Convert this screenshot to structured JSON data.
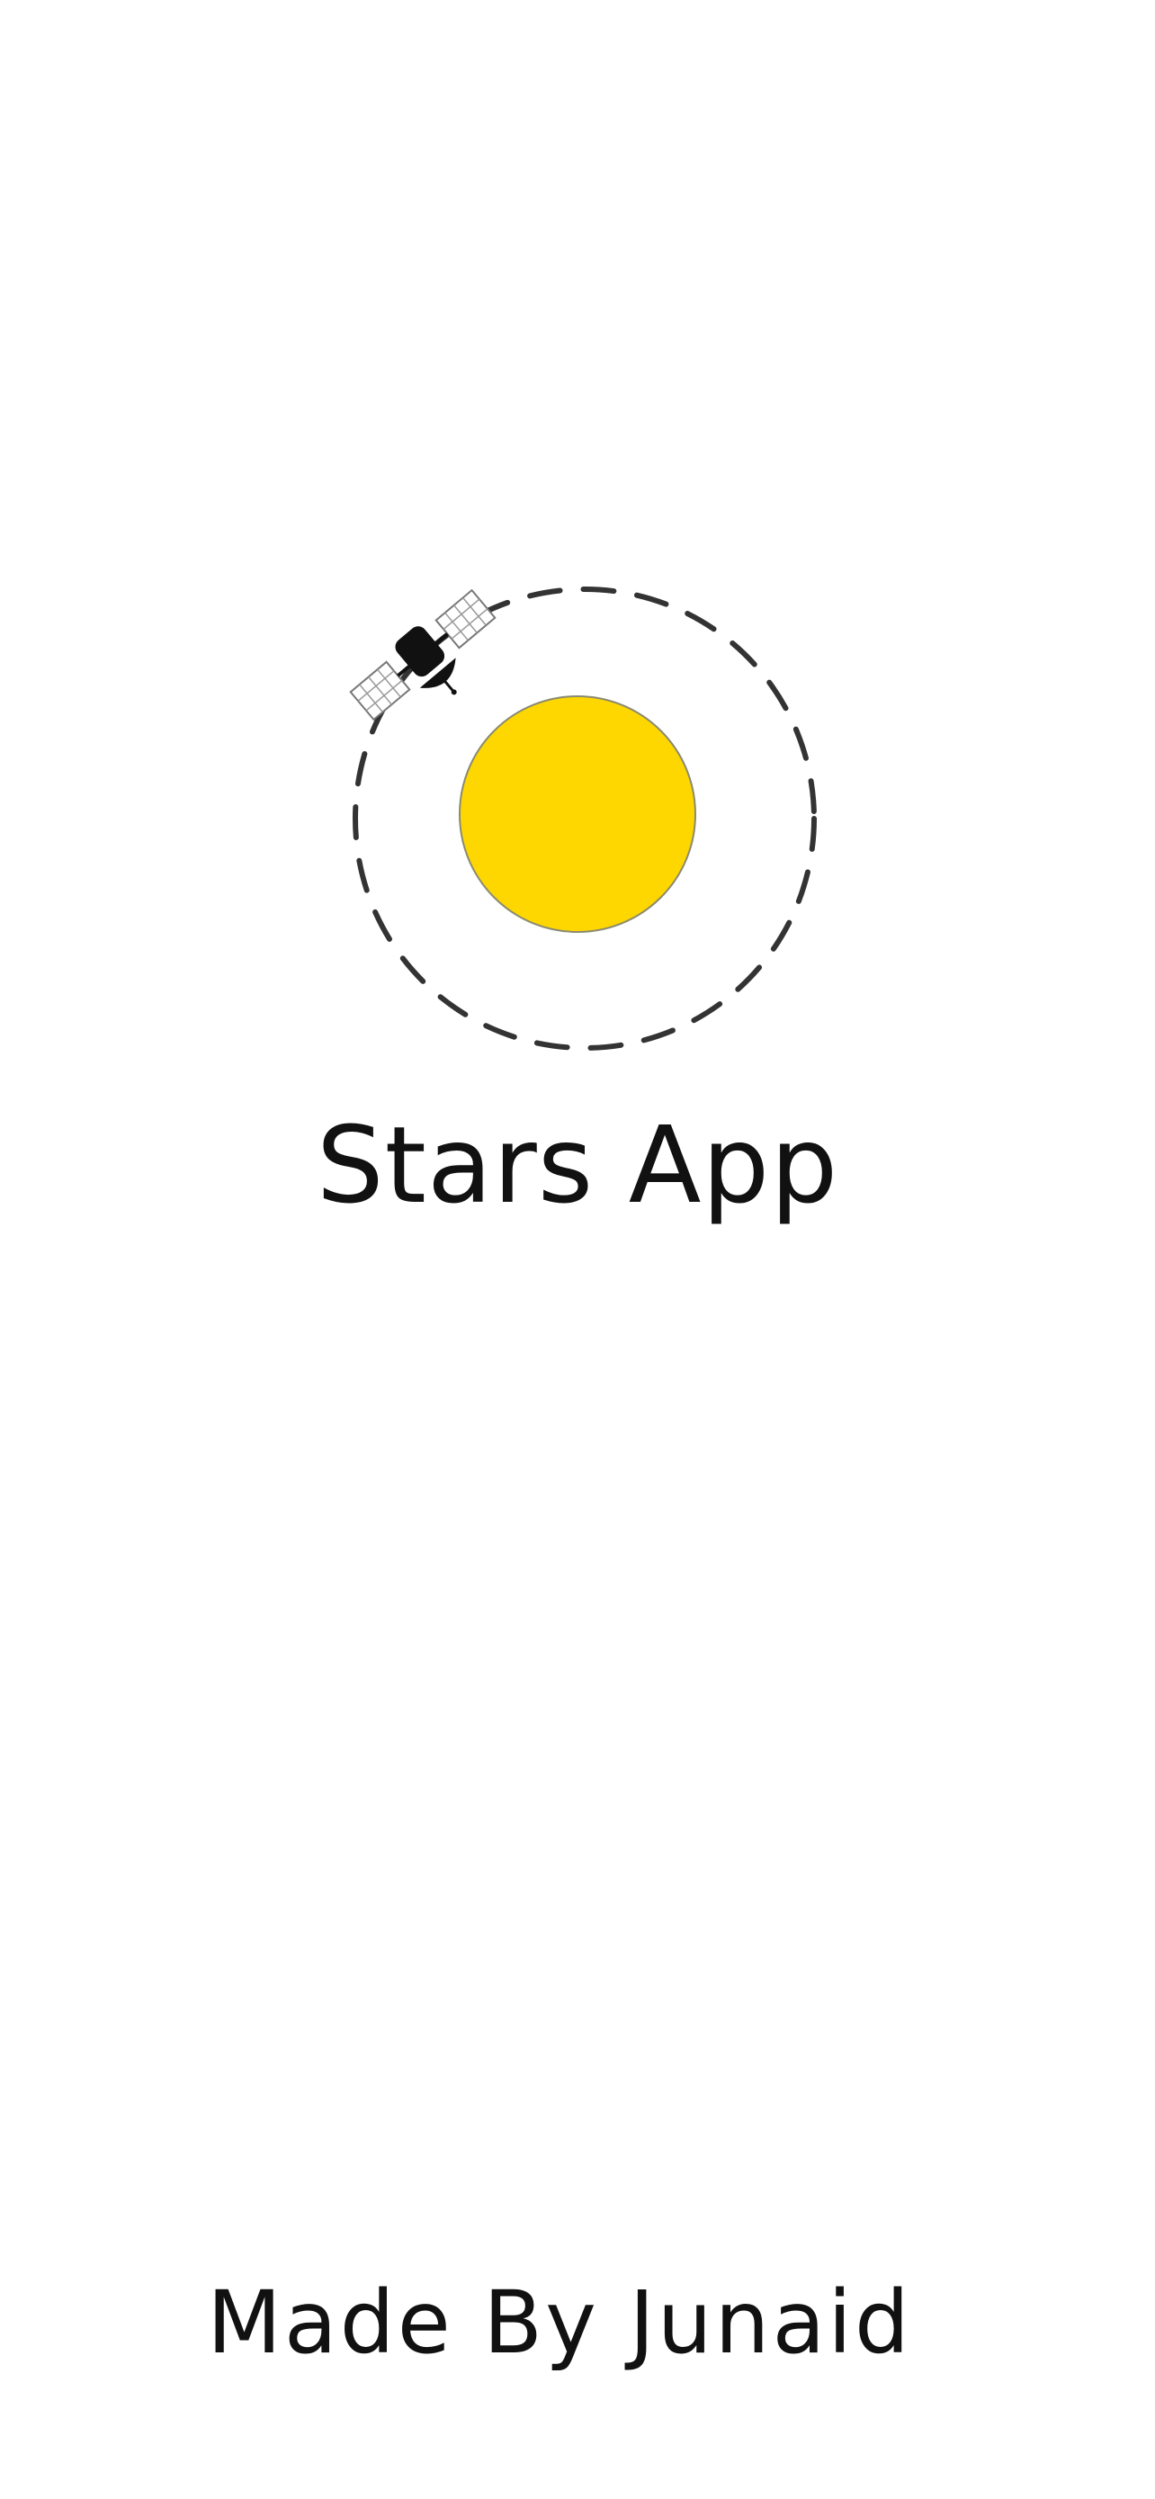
{
  "app": {
    "title": "Stars App",
    "credit": "Made By Junaid"
  },
  "logo": {
    "icons": [
      "sun-icon",
      "orbit-path-icon",
      "satellite-icon"
    ],
    "sun_color": "#FFD700",
    "orbit_color": "#333333",
    "satellite_body_color": "#111111",
    "panel_color": "#888888"
  }
}
